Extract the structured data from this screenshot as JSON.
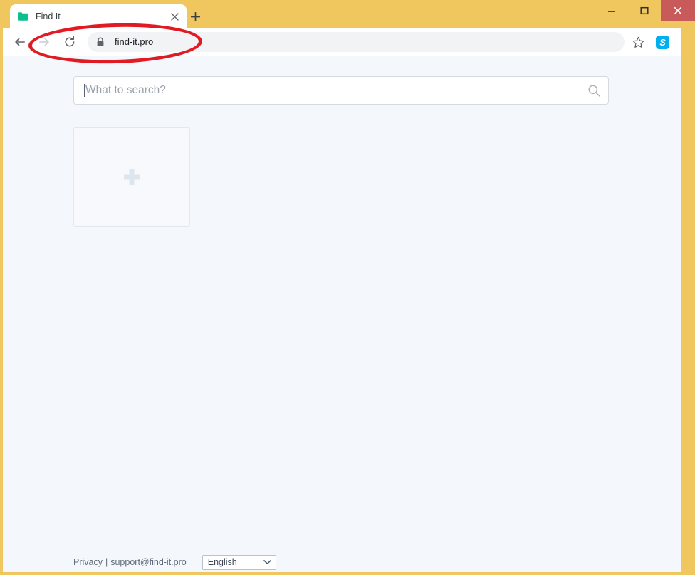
{
  "browser": {
    "tab": {
      "title": "Find It",
      "favicon_icon": "folder-icon",
      "close_icon": "close-icon"
    },
    "new_tab_icon": "plus-icon",
    "window_controls": {
      "minimize_icon": "minimize-icon",
      "maximize_icon": "maximize-icon",
      "close_icon": "close-icon"
    },
    "toolbar": {
      "back_icon": "back-arrow-icon",
      "forward_icon": "forward-arrow-icon",
      "reload_icon": "reload-icon",
      "lock_icon": "lock-icon",
      "url": "find-it.pro",
      "bookmark_icon": "star-icon",
      "extension_icon": "skype-icon"
    }
  },
  "page": {
    "search": {
      "placeholder": "What to search?",
      "submit_icon": "search-icon"
    },
    "shortcuts": {
      "add_tile_icon": "plus-icon"
    },
    "footer": {
      "privacy_label": "Privacy",
      "separator": "|",
      "support_email": "support@find-it.pro",
      "language_value": "English",
      "language_caret_icon": "chevron-down-icon"
    }
  },
  "annotation": {
    "shape": "ellipse-highlight",
    "color": "#e01b24",
    "target": "address-bar"
  },
  "colors": {
    "window_frame": "#efc75e",
    "close_button": "#c85a5a",
    "page_background": "#f4f7fb",
    "favicon_green": "#0ac18e",
    "skype_blue": "#00aff0",
    "annotation_red": "#e01b24"
  }
}
